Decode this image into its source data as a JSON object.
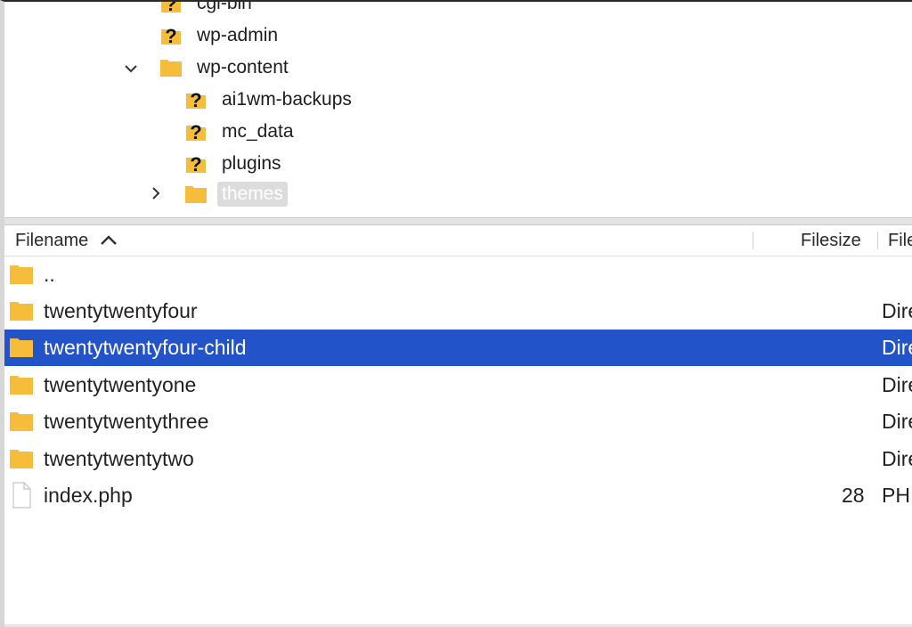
{
  "tree": {
    "items": [
      {
        "label": "cgi-bin",
        "icon": "question-folder-icon",
        "chevron": ""
      },
      {
        "label": "wp-admin",
        "icon": "question-folder-icon",
        "chevron": ""
      },
      {
        "label": "wp-content",
        "icon": "folder-icon",
        "chevron": "⌄"
      },
      {
        "label": "ai1wm-backups",
        "icon": "question-folder-icon",
        "chevron": ""
      },
      {
        "label": "mc_data",
        "icon": "question-folder-icon",
        "chevron": ""
      },
      {
        "label": "plugins",
        "icon": "question-folder-icon",
        "chevron": ""
      },
      {
        "label": "themes",
        "icon": "folder-icon",
        "chevron": "›"
      },
      {
        "label": "",
        "icon": "question-folder-icon",
        "chevron": ""
      }
    ]
  },
  "list": {
    "columns": {
      "filename": "Filename",
      "filesize": "Filesize",
      "filetype": "File"
    },
    "sort_indicator": "chevron-up-icon",
    "rows": [
      {
        "name": "..",
        "size": "",
        "type": "",
        "icon": "folder-icon"
      },
      {
        "name": "twentytwentyfour",
        "size": "",
        "type": "Dire",
        "icon": "folder-icon"
      },
      {
        "name": "twentytwentyfour-child",
        "size": "",
        "type": "Dire",
        "icon": "folder-icon"
      },
      {
        "name": "twentytwentyone",
        "size": "",
        "type": "Dire",
        "icon": "folder-icon"
      },
      {
        "name": "twentytwentythree",
        "size": "",
        "type": "Dire",
        "icon": "folder-icon"
      },
      {
        "name": "twentytwentytwo",
        "size": "",
        "type": "Dire",
        "icon": "folder-icon"
      },
      {
        "name": "index.php",
        "size": "28",
        "type": "PH",
        "icon": "file-icon"
      }
    ]
  },
  "colors": {
    "selection": "#2253c9",
    "folder": "#f5bd3a",
    "tree_selection": "#dcdcdc"
  }
}
